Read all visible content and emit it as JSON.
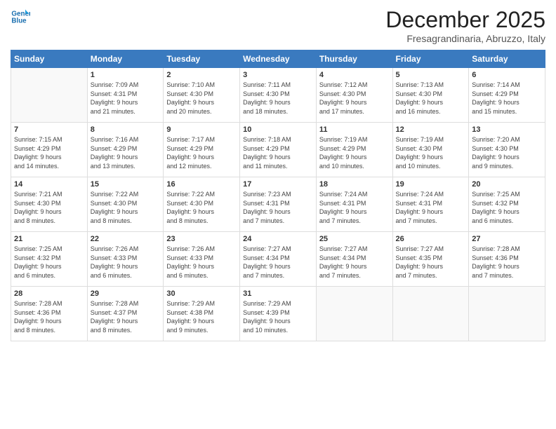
{
  "header": {
    "logo_line1": "General",
    "logo_line2": "Blue",
    "month": "December 2025",
    "location": "Fresagrandinaria, Abruzzo, Italy"
  },
  "days_of_week": [
    "Sunday",
    "Monday",
    "Tuesday",
    "Wednesday",
    "Thursday",
    "Friday",
    "Saturday"
  ],
  "weeks": [
    [
      {
        "num": "",
        "info": ""
      },
      {
        "num": "1",
        "info": "Sunrise: 7:09 AM\nSunset: 4:31 PM\nDaylight: 9 hours\nand 21 minutes."
      },
      {
        "num": "2",
        "info": "Sunrise: 7:10 AM\nSunset: 4:30 PM\nDaylight: 9 hours\nand 20 minutes."
      },
      {
        "num": "3",
        "info": "Sunrise: 7:11 AM\nSunset: 4:30 PM\nDaylight: 9 hours\nand 18 minutes."
      },
      {
        "num": "4",
        "info": "Sunrise: 7:12 AM\nSunset: 4:30 PM\nDaylight: 9 hours\nand 17 minutes."
      },
      {
        "num": "5",
        "info": "Sunrise: 7:13 AM\nSunset: 4:30 PM\nDaylight: 9 hours\nand 16 minutes."
      },
      {
        "num": "6",
        "info": "Sunrise: 7:14 AM\nSunset: 4:29 PM\nDaylight: 9 hours\nand 15 minutes."
      }
    ],
    [
      {
        "num": "7",
        "info": "Sunrise: 7:15 AM\nSunset: 4:29 PM\nDaylight: 9 hours\nand 14 minutes."
      },
      {
        "num": "8",
        "info": "Sunrise: 7:16 AM\nSunset: 4:29 PM\nDaylight: 9 hours\nand 13 minutes."
      },
      {
        "num": "9",
        "info": "Sunrise: 7:17 AM\nSunset: 4:29 PM\nDaylight: 9 hours\nand 12 minutes."
      },
      {
        "num": "10",
        "info": "Sunrise: 7:18 AM\nSunset: 4:29 PM\nDaylight: 9 hours\nand 11 minutes."
      },
      {
        "num": "11",
        "info": "Sunrise: 7:19 AM\nSunset: 4:29 PM\nDaylight: 9 hours\nand 10 minutes."
      },
      {
        "num": "12",
        "info": "Sunrise: 7:19 AM\nSunset: 4:30 PM\nDaylight: 9 hours\nand 10 minutes."
      },
      {
        "num": "13",
        "info": "Sunrise: 7:20 AM\nSunset: 4:30 PM\nDaylight: 9 hours\nand 9 minutes."
      }
    ],
    [
      {
        "num": "14",
        "info": "Sunrise: 7:21 AM\nSunset: 4:30 PM\nDaylight: 9 hours\nand 8 minutes."
      },
      {
        "num": "15",
        "info": "Sunrise: 7:22 AM\nSunset: 4:30 PM\nDaylight: 9 hours\nand 8 minutes."
      },
      {
        "num": "16",
        "info": "Sunrise: 7:22 AM\nSunset: 4:30 PM\nDaylight: 9 hours\nand 8 minutes."
      },
      {
        "num": "17",
        "info": "Sunrise: 7:23 AM\nSunset: 4:31 PM\nDaylight: 9 hours\nand 7 minutes."
      },
      {
        "num": "18",
        "info": "Sunrise: 7:24 AM\nSunset: 4:31 PM\nDaylight: 9 hours\nand 7 minutes."
      },
      {
        "num": "19",
        "info": "Sunrise: 7:24 AM\nSunset: 4:31 PM\nDaylight: 9 hours\nand 7 minutes."
      },
      {
        "num": "20",
        "info": "Sunrise: 7:25 AM\nSunset: 4:32 PM\nDaylight: 9 hours\nand 6 minutes."
      }
    ],
    [
      {
        "num": "21",
        "info": "Sunrise: 7:25 AM\nSunset: 4:32 PM\nDaylight: 9 hours\nand 6 minutes."
      },
      {
        "num": "22",
        "info": "Sunrise: 7:26 AM\nSunset: 4:33 PM\nDaylight: 9 hours\nand 6 minutes."
      },
      {
        "num": "23",
        "info": "Sunrise: 7:26 AM\nSunset: 4:33 PM\nDaylight: 9 hours\nand 6 minutes."
      },
      {
        "num": "24",
        "info": "Sunrise: 7:27 AM\nSunset: 4:34 PM\nDaylight: 9 hours\nand 7 minutes."
      },
      {
        "num": "25",
        "info": "Sunrise: 7:27 AM\nSunset: 4:34 PM\nDaylight: 9 hours\nand 7 minutes."
      },
      {
        "num": "26",
        "info": "Sunrise: 7:27 AM\nSunset: 4:35 PM\nDaylight: 9 hours\nand 7 minutes."
      },
      {
        "num": "27",
        "info": "Sunrise: 7:28 AM\nSunset: 4:36 PM\nDaylight: 9 hours\nand 7 minutes."
      }
    ],
    [
      {
        "num": "28",
        "info": "Sunrise: 7:28 AM\nSunset: 4:36 PM\nDaylight: 9 hours\nand 8 minutes."
      },
      {
        "num": "29",
        "info": "Sunrise: 7:28 AM\nSunset: 4:37 PM\nDaylight: 9 hours\nand 8 minutes."
      },
      {
        "num": "30",
        "info": "Sunrise: 7:29 AM\nSunset: 4:38 PM\nDaylight: 9 hours\nand 9 minutes."
      },
      {
        "num": "31",
        "info": "Sunrise: 7:29 AM\nSunset: 4:39 PM\nDaylight: 9 hours\nand 10 minutes."
      },
      {
        "num": "",
        "info": ""
      },
      {
        "num": "",
        "info": ""
      },
      {
        "num": "",
        "info": ""
      }
    ]
  ]
}
